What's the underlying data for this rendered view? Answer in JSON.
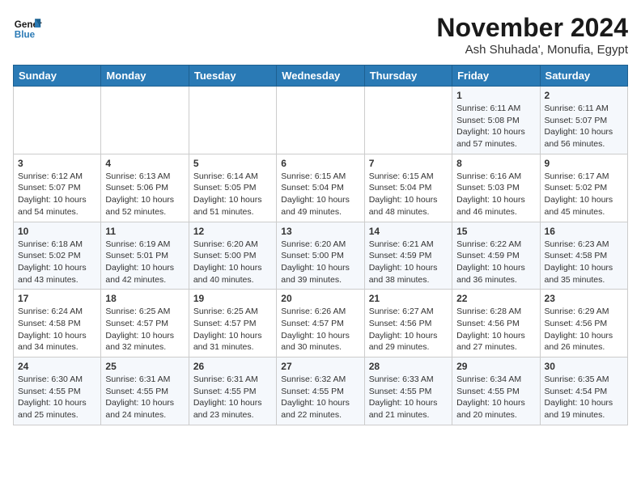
{
  "header": {
    "logo_line1": "General",
    "logo_line2": "Blue",
    "month": "November 2024",
    "location": "Ash Shuhada', Monufia, Egypt"
  },
  "weekdays": [
    "Sunday",
    "Monday",
    "Tuesday",
    "Wednesday",
    "Thursday",
    "Friday",
    "Saturday"
  ],
  "weeks": [
    [
      {
        "day": "",
        "info": ""
      },
      {
        "day": "",
        "info": ""
      },
      {
        "day": "",
        "info": ""
      },
      {
        "day": "",
        "info": ""
      },
      {
        "day": "",
        "info": ""
      },
      {
        "day": "1",
        "info": "Sunrise: 6:11 AM\nSunset: 5:08 PM\nDaylight: 10 hours and 57 minutes."
      },
      {
        "day": "2",
        "info": "Sunrise: 6:11 AM\nSunset: 5:07 PM\nDaylight: 10 hours and 56 minutes."
      }
    ],
    [
      {
        "day": "3",
        "info": "Sunrise: 6:12 AM\nSunset: 5:07 PM\nDaylight: 10 hours and 54 minutes."
      },
      {
        "day": "4",
        "info": "Sunrise: 6:13 AM\nSunset: 5:06 PM\nDaylight: 10 hours and 52 minutes."
      },
      {
        "day": "5",
        "info": "Sunrise: 6:14 AM\nSunset: 5:05 PM\nDaylight: 10 hours and 51 minutes."
      },
      {
        "day": "6",
        "info": "Sunrise: 6:15 AM\nSunset: 5:04 PM\nDaylight: 10 hours and 49 minutes."
      },
      {
        "day": "7",
        "info": "Sunrise: 6:15 AM\nSunset: 5:04 PM\nDaylight: 10 hours and 48 minutes."
      },
      {
        "day": "8",
        "info": "Sunrise: 6:16 AM\nSunset: 5:03 PM\nDaylight: 10 hours and 46 minutes."
      },
      {
        "day": "9",
        "info": "Sunrise: 6:17 AM\nSunset: 5:02 PM\nDaylight: 10 hours and 45 minutes."
      }
    ],
    [
      {
        "day": "10",
        "info": "Sunrise: 6:18 AM\nSunset: 5:02 PM\nDaylight: 10 hours and 43 minutes."
      },
      {
        "day": "11",
        "info": "Sunrise: 6:19 AM\nSunset: 5:01 PM\nDaylight: 10 hours and 42 minutes."
      },
      {
        "day": "12",
        "info": "Sunrise: 6:20 AM\nSunset: 5:00 PM\nDaylight: 10 hours and 40 minutes."
      },
      {
        "day": "13",
        "info": "Sunrise: 6:20 AM\nSunset: 5:00 PM\nDaylight: 10 hours and 39 minutes."
      },
      {
        "day": "14",
        "info": "Sunrise: 6:21 AM\nSunset: 4:59 PM\nDaylight: 10 hours and 38 minutes."
      },
      {
        "day": "15",
        "info": "Sunrise: 6:22 AM\nSunset: 4:59 PM\nDaylight: 10 hours and 36 minutes."
      },
      {
        "day": "16",
        "info": "Sunrise: 6:23 AM\nSunset: 4:58 PM\nDaylight: 10 hours and 35 minutes."
      }
    ],
    [
      {
        "day": "17",
        "info": "Sunrise: 6:24 AM\nSunset: 4:58 PM\nDaylight: 10 hours and 34 minutes."
      },
      {
        "day": "18",
        "info": "Sunrise: 6:25 AM\nSunset: 4:57 PM\nDaylight: 10 hours and 32 minutes."
      },
      {
        "day": "19",
        "info": "Sunrise: 6:25 AM\nSunset: 4:57 PM\nDaylight: 10 hours and 31 minutes."
      },
      {
        "day": "20",
        "info": "Sunrise: 6:26 AM\nSunset: 4:57 PM\nDaylight: 10 hours and 30 minutes."
      },
      {
        "day": "21",
        "info": "Sunrise: 6:27 AM\nSunset: 4:56 PM\nDaylight: 10 hours and 29 minutes."
      },
      {
        "day": "22",
        "info": "Sunrise: 6:28 AM\nSunset: 4:56 PM\nDaylight: 10 hours and 27 minutes."
      },
      {
        "day": "23",
        "info": "Sunrise: 6:29 AM\nSunset: 4:56 PM\nDaylight: 10 hours and 26 minutes."
      }
    ],
    [
      {
        "day": "24",
        "info": "Sunrise: 6:30 AM\nSunset: 4:55 PM\nDaylight: 10 hours and 25 minutes."
      },
      {
        "day": "25",
        "info": "Sunrise: 6:31 AM\nSunset: 4:55 PM\nDaylight: 10 hours and 24 minutes."
      },
      {
        "day": "26",
        "info": "Sunrise: 6:31 AM\nSunset: 4:55 PM\nDaylight: 10 hours and 23 minutes."
      },
      {
        "day": "27",
        "info": "Sunrise: 6:32 AM\nSunset: 4:55 PM\nDaylight: 10 hours and 22 minutes."
      },
      {
        "day": "28",
        "info": "Sunrise: 6:33 AM\nSunset: 4:55 PM\nDaylight: 10 hours and 21 minutes."
      },
      {
        "day": "29",
        "info": "Sunrise: 6:34 AM\nSunset: 4:55 PM\nDaylight: 10 hours and 20 minutes."
      },
      {
        "day": "30",
        "info": "Sunrise: 6:35 AM\nSunset: 4:54 PM\nDaylight: 10 hours and 19 minutes."
      }
    ]
  ]
}
